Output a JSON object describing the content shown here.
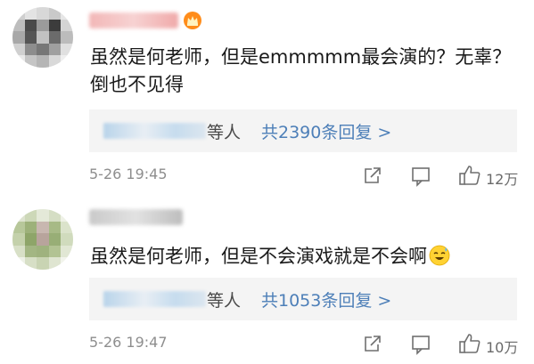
{
  "comments": [
    {
      "text_lines": [
        "虽然是何老师，但是emmmmm最会演的？无辜？",
        "倒也不见得"
      ],
      "reply_tail": "等人",
      "reply_count": "共2390条回复 >",
      "timestamp": "5-26 19:45",
      "likes": "12万"
    },
    {
      "text": "虽然是何老师，但是不会演戏就是不会啊",
      "reply_tail": "等人",
      "reply_count": "共1053条回复 >",
      "timestamp": "5-26 19:47",
      "likes": "10万"
    }
  ],
  "icons": [
    "share-icon",
    "comment-icon",
    "like-icon",
    "crown-badge-icon",
    "sweat-smile-emoji-icon"
  ],
  "colors": {
    "link_blue": "#4d7fb8",
    "reply_bg": "#f4f4f4",
    "meta_gray": "#8e8e8e"
  }
}
